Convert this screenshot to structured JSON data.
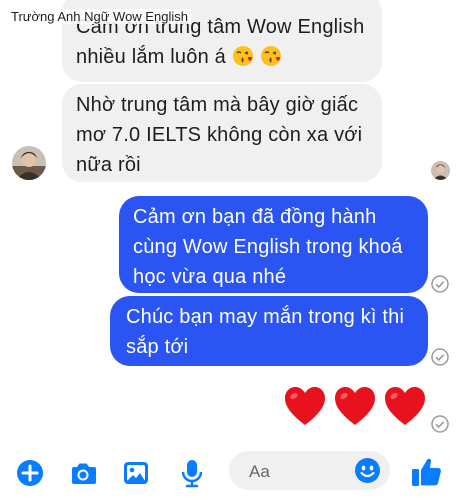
{
  "watermark": "Trường Anh Ngữ Wow English",
  "messages": [
    {
      "direction": "incoming",
      "lines": [
        "Cảm ơn trung tâm Wow English",
        "nhiều lắm luôn á"
      ],
      "emojis": [
        "kissing-heart-emoji",
        "kissing-heart-emoji"
      ]
    },
    {
      "direction": "incoming",
      "lines": [
        "Nhờ trung tâm mà bây giờ giấc",
        "mơ 7.0 IELTS không còn xa với",
        "nữa rồi"
      ]
    },
    {
      "direction": "outgoing",
      "lines": [
        "Cảm ơn bạn đã đồng hành",
        "cùng Wow English trong khoá",
        "học vừa qua nhé"
      ]
    },
    {
      "direction": "outgoing",
      "lines": [
        "Chúc bạn may mắn trong kì thi",
        "sắp tới"
      ]
    }
  ],
  "reactions": [
    "red-heart",
    "red-heart",
    "red-heart"
  ],
  "composer": {
    "placeholder": "Aa",
    "icons": [
      "add-circle-icon",
      "camera-icon",
      "photo-icon",
      "microphone-icon",
      "emoji-icon",
      "thumbs-up-icon"
    ]
  },
  "colors": {
    "accent": "#0a7cff",
    "outgoing_bubble": "#2a55f3",
    "incoming_bubble": "#f0f0f0",
    "heart": "#e8121f"
  }
}
